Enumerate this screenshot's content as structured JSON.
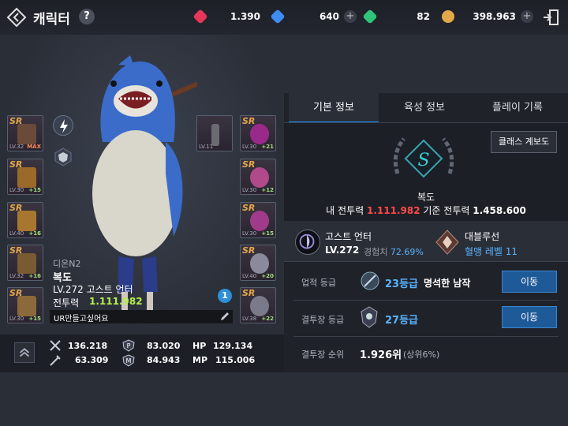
{
  "header": {
    "title": "캐릭터",
    "help": "?",
    "currencies": [
      {
        "name": "red-gem-icon",
        "value": "1.390",
        "color": "#e8365a",
        "has_plus": false
      },
      {
        "name": "blue-gem-icon",
        "value": "640",
        "color": "#3f8cf0",
        "has_plus": true
      },
      {
        "name": "green-gem-icon",
        "value": "82",
        "color": "#2fc47a",
        "has_plus": false
      },
      {
        "name": "gold-coin-icon",
        "value": "398.963",
        "color": "#e3a84a",
        "has_plus": true
      }
    ]
  },
  "equipment_left": [
    {
      "grade": "SR",
      "level": "LV.32",
      "plus": "MAX",
      "color": "#6a4a38"
    },
    {
      "grade": "SR",
      "level": "LV.30",
      "plus": "+15",
      "color": "#9a6a2a"
    },
    {
      "grade": "SR",
      "level": "LV.40",
      "plus": "+16",
      "color": "#a8772f"
    },
    {
      "grade": "SR",
      "level": "LV.32",
      "plus": "+16",
      "color": "#7a5a30"
    },
    {
      "grade": "SR",
      "level": "LV.30",
      "plus": "+15",
      "color": "#8a6a3a"
    }
  ],
  "equipment_right": [
    {
      "grade": "SR",
      "level": "LV.11",
      "plus": "",
      "color": "#6a6a70"
    },
    {
      "grade": "SR",
      "level": "LV.30",
      "plus": "+21",
      "color": "#9a2a8a"
    },
    {
      "grade": "SR",
      "level": "LV.30",
      "plus": "+12",
      "color": "#b04a8a"
    },
    {
      "grade": "SR",
      "level": "LV.30",
      "plus": "+15",
      "color": "#a03a8a"
    },
    {
      "grade": "SR",
      "level": "LV.40",
      "plus": "+20",
      "color": "#8a8a9a"
    },
    {
      "grade": "SR",
      "level": "LV.38",
      "plus": "+22",
      "color": "#7a7a8a"
    }
  ],
  "character": {
    "server": "디온N2",
    "name": "복도",
    "level_class": "LV.272  고스트 언터",
    "power_label": "전투력",
    "power_value": "1.111.982",
    "guild_message": "UR만들고싶어요",
    "notification": "1"
  },
  "stats": [
    {
      "icon": "attack-icon",
      "value": "136.218"
    },
    {
      "icon": "physical-defense-icon",
      "value": "83.020"
    },
    {
      "label": "HP",
      "value": "129.134"
    },
    {
      "icon": "magic-attack-icon",
      "value": "63.309"
    },
    {
      "icon": "magic-defense-icon",
      "value": "84.943"
    },
    {
      "label": "MP",
      "value": "115.006"
    }
  ],
  "tabs": [
    "기본 정보",
    "육성 정보",
    "플레이 기록"
  ],
  "info": {
    "class_board_button": "클래스 계보도",
    "emblem_letter": "S",
    "name": "복도",
    "my_power_label": "내 전투력",
    "my_power_value": "1.111.982",
    "base_power_label": "기준 전투력",
    "base_power_value": "1.458.600",
    "class_name": "고스트 언터",
    "class_level": "LV.272",
    "exp_label": "경험치",
    "exp_value": "72.69%",
    "guild_name": "대블루선",
    "guild_level": "혈맹 레벨 11",
    "achievement_label": "업적 등급",
    "achievement_grade": "23등급",
    "achievement_title": "명석한 남작",
    "arena_label": "결투장 등급",
    "arena_grade": "27등급",
    "rank_label": "결투장 순위",
    "rank_value": "1.926위",
    "rank_percent": "(상위6%)",
    "move_button": "이동"
  }
}
